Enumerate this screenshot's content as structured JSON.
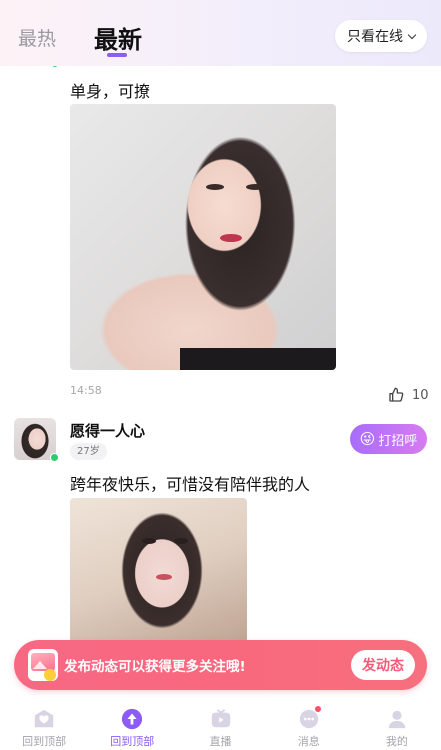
{
  "header": {
    "tab_hot": "最热",
    "tab_new": "最新",
    "filter_button": "只看在线"
  },
  "posts": [
    {
      "text": "单身，可撩",
      "time": "14:58",
      "likes": "10"
    },
    {
      "username": "愿得一人心",
      "age": "27岁",
      "greet_button": "打招呼",
      "text": "跨年夜快乐，可惜没有陪伴我的人"
    }
  ],
  "promo": {
    "text": "发布动态可以获得更多关注哦!",
    "button": "发动态"
  },
  "bottom_nav": [
    {
      "label": "回到顶部",
      "icon": "home-heart-icon",
      "active": false
    },
    {
      "label": "回到顶部",
      "icon": "arrow-up-icon",
      "active": true
    },
    {
      "label": "直播",
      "icon": "tv-icon",
      "active": false
    },
    {
      "label": "消息",
      "icon": "chat-icon",
      "active": false
    },
    {
      "label": "我的",
      "icon": "profile-icon",
      "active": false
    }
  ],
  "colors": {
    "accent": "#8b5cf6",
    "promo_bg": "#f76883",
    "online": "#2ecc71"
  }
}
